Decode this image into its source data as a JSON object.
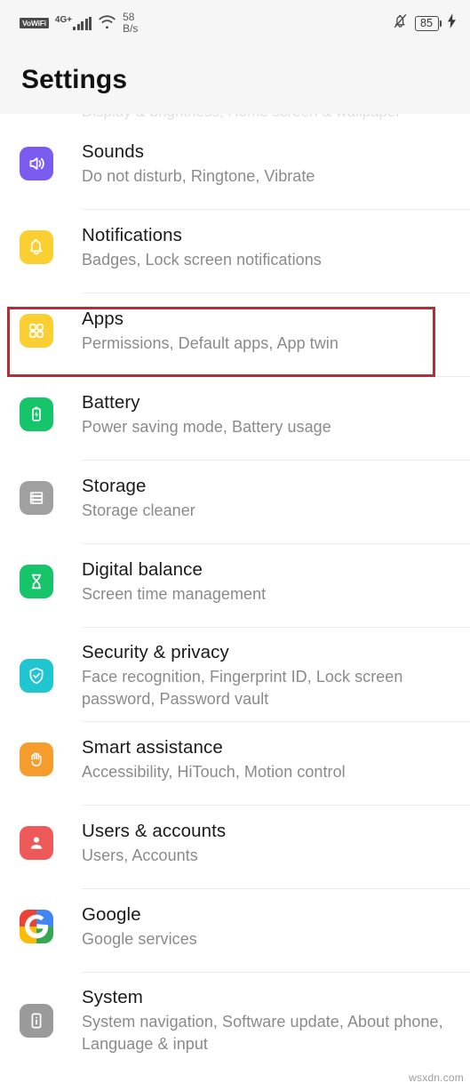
{
  "status_bar": {
    "vowifi_label": "VoWiFi",
    "network_label": "4G+",
    "signal_icon": "signal-bars-icon",
    "wifi_icon": "wifi-icon",
    "data_speed_value": "58",
    "data_speed_unit": "B/s",
    "mute_icon": "bell-muted-icon",
    "battery_level": "85",
    "charging_icon": "lightning-bolt-icon"
  },
  "header": {
    "title": "Settings"
  },
  "ghost_row": {
    "text": "Display & brightness, Home screen & wallpaper"
  },
  "highlight": {
    "color": "#b0303a",
    "target": "Apps"
  },
  "watermark": {
    "text": "wsxdn.com"
  },
  "list": {
    "items": [
      {
        "title": "Sounds",
        "subtitle": "Do not disturb, Ringtone, Vibrate",
        "icon": "speaker-icon",
        "icon_color": "#7c5cf0"
      },
      {
        "title": "Notifications",
        "subtitle": "Badges, Lock screen notifications",
        "icon": "bell-icon",
        "icon_color": "#f9cf32"
      },
      {
        "title": "Apps",
        "subtitle": "Permissions, Default apps, App twin",
        "icon": "apps-grid-icon",
        "icon_color": "#f9cf32"
      },
      {
        "title": "Battery",
        "subtitle": "Power saving mode, Battery usage",
        "icon": "battery-icon",
        "icon_color": "#16c46a"
      },
      {
        "title": "Storage",
        "subtitle": "Storage cleaner",
        "icon": "storage-icon",
        "icon_color": "#a0a0a0"
      },
      {
        "title": "Digital balance",
        "subtitle": "Screen time management",
        "icon": "hourglass-icon",
        "icon_color": "#16c46a"
      },
      {
        "title": "Security & privacy",
        "subtitle": "Face recognition, Fingerprint ID, Lock screen password, Password vault",
        "icon": "shield-check-icon",
        "icon_color": "#20c6cf"
      },
      {
        "title": "Smart assistance",
        "subtitle": "Accessibility, HiTouch, Motion control",
        "icon": "hand-icon",
        "icon_color": "#f59c2c"
      },
      {
        "title": "Users & accounts",
        "subtitle": "Users, Accounts",
        "icon": "person-icon",
        "icon_color": "#ee5a5a"
      },
      {
        "title": "Google",
        "subtitle": "Google services",
        "icon": "google-logo-icon",
        "icon_color": "#ffffff"
      },
      {
        "title": "System",
        "subtitle": "System navigation, Software update, About phone, Language & input",
        "icon": "phone-info-icon",
        "icon_color": "#9a9a9a"
      }
    ]
  }
}
